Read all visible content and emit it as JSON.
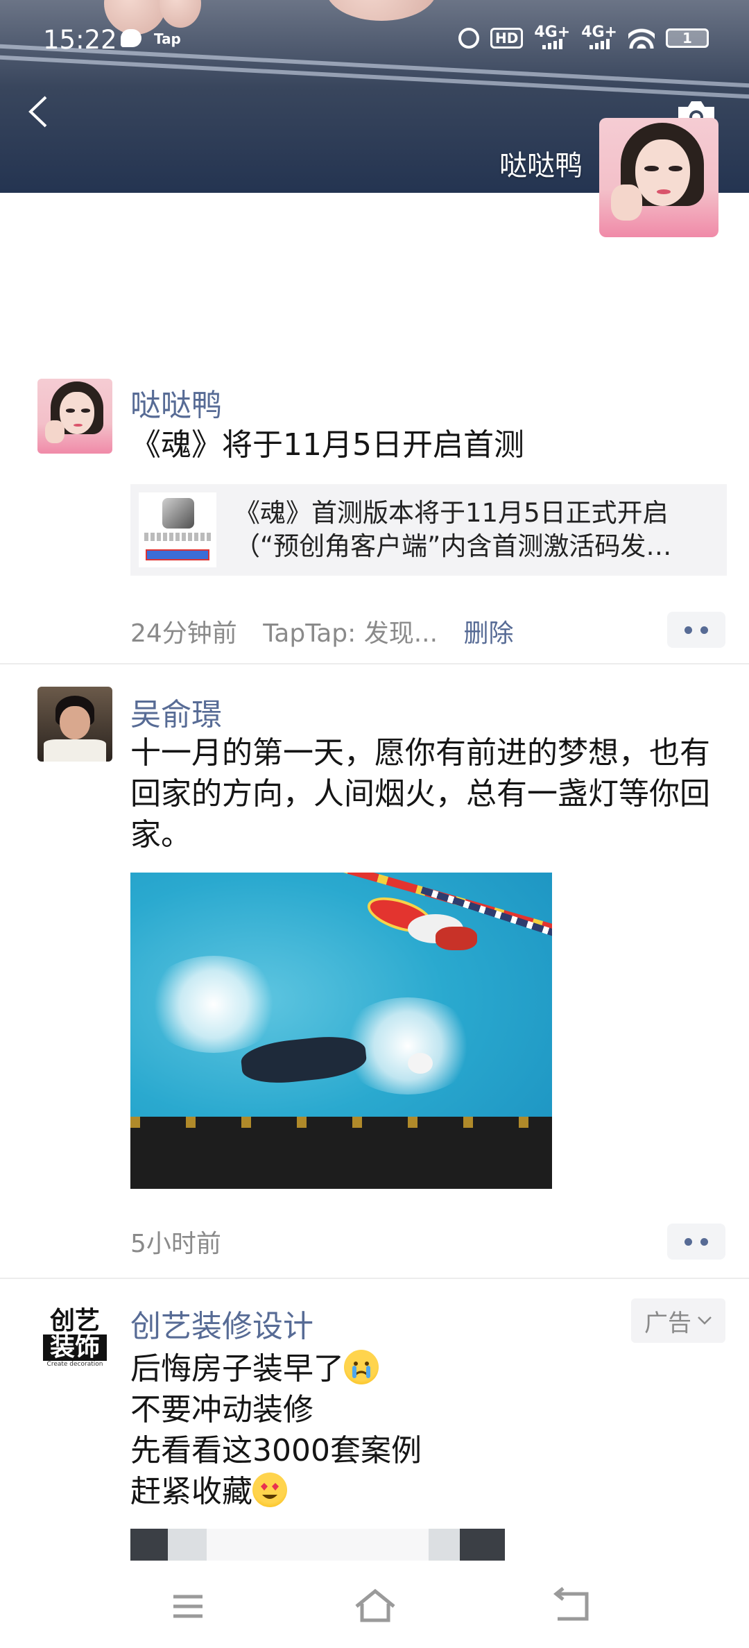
{
  "status_bar": {
    "time": "15:22",
    "hd_label": "HD",
    "net1": "4G+",
    "net2": "4G+",
    "battery": "1",
    "app_badge": "Tap"
  },
  "header": {
    "name": "哒哒鸭"
  },
  "posts": [
    {
      "author": "哒哒鸭",
      "text": "《魂》将于11月5日开启首测",
      "share": {
        "line1": "《魂》首测版本将于11月5日正式开启",
        "line2": "（“预创角客户端”内含首测激活码发…"
      },
      "time": "24分钟前",
      "source": "TapTap: 发现...",
      "delete": "删除"
    },
    {
      "author": "吴俞璟",
      "text": "十一月的第一天，愿你有前进的梦想，也有回家的方向，人间烟火，总有一盏灯等你回家。",
      "time": "5小时前"
    },
    {
      "author": "创艺装修设计",
      "logo_line1": "创艺",
      "logo_line2": "装饰",
      "logo_sub": "Create decoration",
      "ad_label": "广告",
      "lines": [
        "后悔房子装早了",
        "不要冲动装修",
        "先看看这3000套案例",
        "赶紧收藏"
      ]
    }
  ],
  "colors": {
    "link": "#576b95",
    "meta": "#8a8a8a",
    "divider": "#ececec"
  },
  "icons": [
    "back-arrow-icon",
    "camera-icon",
    "more-dots-icon",
    "menu-icon",
    "home-icon",
    "back-icon",
    "chevron-down-icon"
  ]
}
